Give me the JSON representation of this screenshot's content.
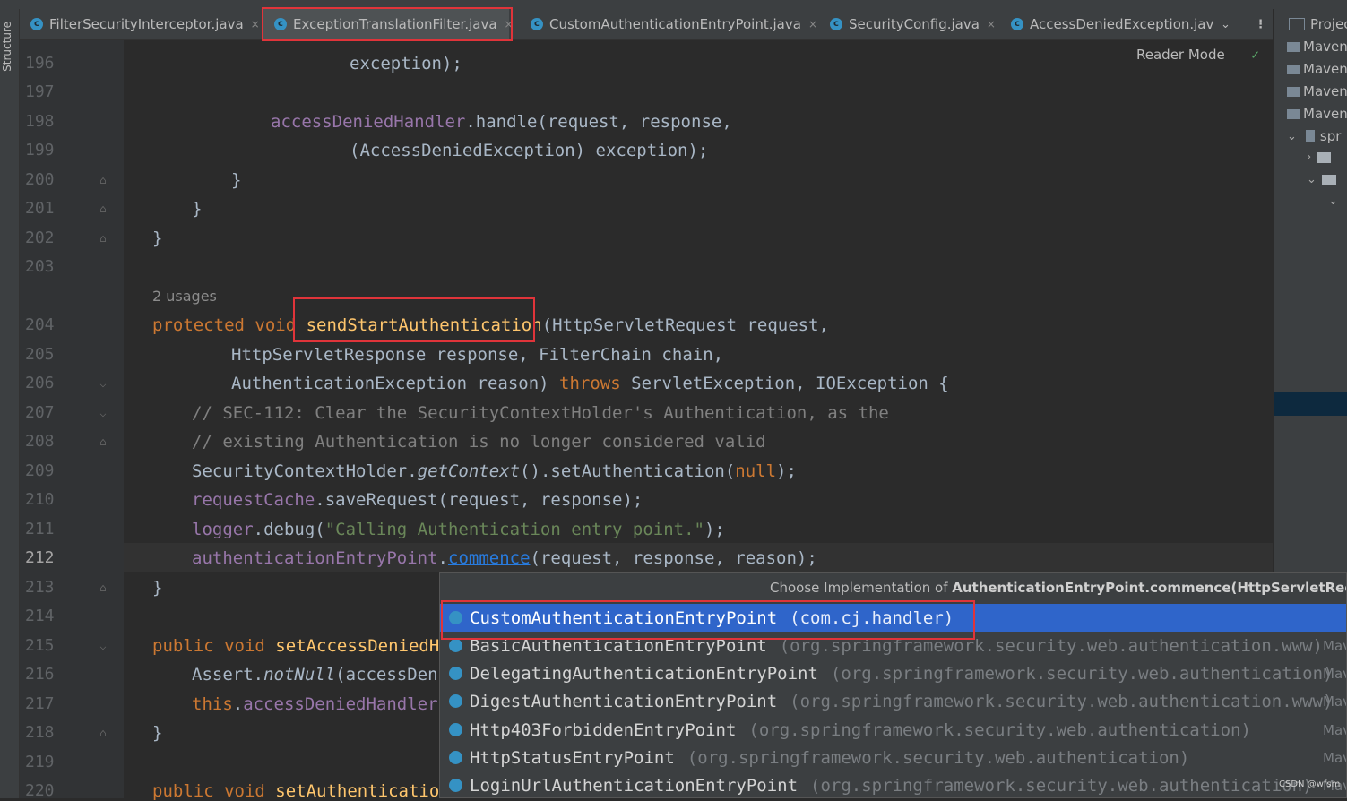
{
  "tabs": [
    {
      "label": "FilterSecurityInterceptor.java",
      "close": "×"
    },
    {
      "label": "ExceptionTranslationFilter.java",
      "close": "×"
    },
    {
      "label": "CustomAuthenticationEntryPoint.java",
      "close": "×"
    },
    {
      "label": "SecurityConfig.java",
      "close": "×"
    },
    {
      "label": "AccessDeniedException.jav",
      "close": ""
    }
  ],
  "tab_overflow_icon": "chevron-down-icon",
  "tab_menu_icon": "more-vertical-icon",
  "left_toolwindow": {
    "label": "Structure"
  },
  "reader_mode": {
    "label": "Reader Mode",
    "check": "✓"
  },
  "editor": {
    "usages_hint": "2 usages",
    "line_numbers": [
      "196",
      "197",
      "198",
      "199",
      "200",
      "201",
      "202",
      "203",
      "204",
      "205",
      "206",
      "207",
      "208",
      "209",
      "210",
      "211",
      "212",
      "213",
      "214",
      "215",
      "216",
      "217",
      "218",
      "219",
      "220"
    ],
    "current_line": "212",
    "lines": {
      "l196": "exception);",
      "l198_a": "accessDeniedHandler",
      "l198_b": ".handle(request, response,",
      "l199": "(AccessDeniedException) exception);",
      "l200": "}",
      "l201": "}",
      "l202": "}",
      "l204_kw": "protected void ",
      "l204_fn": "sendStartAuthentication",
      "l204_rest": "(HttpServletRequest request,",
      "l205": "HttpServletResponse response, FilterChain chain,",
      "l206_a": "AuthenticationException reason) ",
      "l206_kw": "throws",
      "l206_b": " ServletException, IOException {",
      "l207": "// SEC-112: Clear the SecurityContextHolder's Authentication, as the",
      "l208": "// existing Authentication is no longer considered valid",
      "l209_a": "SecurityContextHolder.",
      "l209_b": "getContext",
      "l209_c": "().setAuthentication(",
      "l209_d": "null",
      "l209_e": ");",
      "l210_a": "requestCache",
      "l210_b": ".saveRequest(request, response);",
      "l211_a": "logger",
      "l211_b": ".debug(",
      "l211_c": "\"Calling Authentication entry point.\"",
      "l211_d": ");",
      "l212_a": "authenticationEntryPoint",
      "l212_b": ".",
      "l212_c": "commence",
      "l212_d": "(request, response, reason);",
      "l213": "}",
      "l215_kw": "public void ",
      "l215_fn": "setAccessDeniedHa",
      "l216_a": "Assert.",
      "l216_b": "notNull",
      "l216_c": "(accessDeni",
      "l217_a": "this",
      "l217_b": ".",
      "l217_c": "accessDeniedHandler",
      "l218": "}",
      "l220_kw": "public void ",
      "l220_fn": "setAuthentication"
    }
  },
  "project_panel": {
    "title": "Projec",
    "items": [
      "Maven",
      "Maven",
      "Maven",
      "Maven",
      "spr"
    ]
  },
  "popup": {
    "header_prefix": "Choose Implementation of ",
    "header_bold": "AuthenticationEntryPoint.commence(HttpServletRequest, H",
    "items": [
      {
        "name": "CustomAuthenticationEntryPoint",
        "pkg": "(com.cj.handler)",
        "lib": ""
      },
      {
        "name": "BasicAuthenticationEntryPoint",
        "pkg": "(org.springframework.security.web.authentication.www)",
        "lib": "Mav"
      },
      {
        "name": "DelegatingAuthenticationEntryPoint",
        "pkg": "(org.springframework.security.web.authentication)",
        "lib": "Mav"
      },
      {
        "name": "DigestAuthenticationEntryPoint",
        "pkg": "(org.springframework.security.web.authentication.www)",
        "lib": "Mav"
      },
      {
        "name": "Http403ForbiddenEntryPoint",
        "pkg": "(org.springframework.security.web.authentication)",
        "lib": "Mav"
      },
      {
        "name": "HttpStatusEntryPoint",
        "pkg": "(org.springframework.security.web.authentication)",
        "lib": "Mav"
      },
      {
        "name": "LoginUrlAuthenticationEntryPoint",
        "pkg": "(org.springframework.security.web.authentication)",
        "lib": "Mav"
      }
    ]
  },
  "watermark": "CSDN @wfsm",
  "colors": {
    "keyword": "#cc7832",
    "function": "#ffc66d",
    "field": "#9876aa",
    "string": "#6a8759",
    "comment": "#808080",
    "selection": "#2f65ca",
    "highlight_box": "#e0343a"
  }
}
